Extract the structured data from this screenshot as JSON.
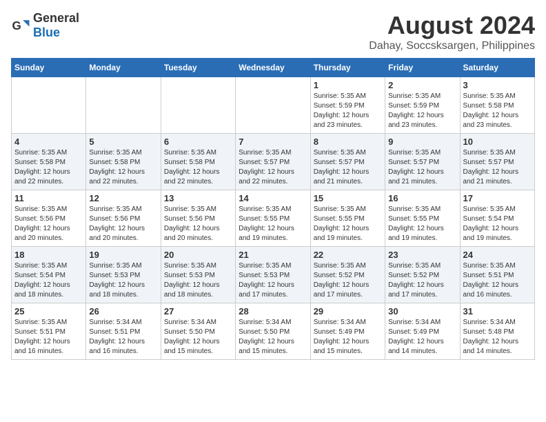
{
  "header": {
    "logo_general": "General",
    "logo_blue": "Blue",
    "title": "August 2024",
    "subtitle": "Dahay, Soccsksargen, Philippines"
  },
  "calendar": {
    "days_of_week": [
      "Sunday",
      "Monday",
      "Tuesday",
      "Wednesday",
      "Thursday",
      "Friday",
      "Saturday"
    ],
    "weeks": [
      {
        "cells": [
          {
            "day": "",
            "detail": ""
          },
          {
            "day": "",
            "detail": ""
          },
          {
            "day": "",
            "detail": ""
          },
          {
            "day": "",
            "detail": ""
          },
          {
            "day": "1",
            "detail": "Sunrise: 5:35 AM\nSunset: 5:59 PM\nDaylight: 12 hours\nand 23 minutes."
          },
          {
            "day": "2",
            "detail": "Sunrise: 5:35 AM\nSunset: 5:59 PM\nDaylight: 12 hours\nand 23 minutes."
          },
          {
            "day": "3",
            "detail": "Sunrise: 5:35 AM\nSunset: 5:58 PM\nDaylight: 12 hours\nand 23 minutes."
          }
        ]
      },
      {
        "cells": [
          {
            "day": "4",
            "detail": "Sunrise: 5:35 AM\nSunset: 5:58 PM\nDaylight: 12 hours\nand 22 minutes."
          },
          {
            "day": "5",
            "detail": "Sunrise: 5:35 AM\nSunset: 5:58 PM\nDaylight: 12 hours\nand 22 minutes."
          },
          {
            "day": "6",
            "detail": "Sunrise: 5:35 AM\nSunset: 5:58 PM\nDaylight: 12 hours\nand 22 minutes."
          },
          {
            "day": "7",
            "detail": "Sunrise: 5:35 AM\nSunset: 5:57 PM\nDaylight: 12 hours\nand 22 minutes."
          },
          {
            "day": "8",
            "detail": "Sunrise: 5:35 AM\nSunset: 5:57 PM\nDaylight: 12 hours\nand 21 minutes."
          },
          {
            "day": "9",
            "detail": "Sunrise: 5:35 AM\nSunset: 5:57 PM\nDaylight: 12 hours\nand 21 minutes."
          },
          {
            "day": "10",
            "detail": "Sunrise: 5:35 AM\nSunset: 5:57 PM\nDaylight: 12 hours\nand 21 minutes."
          }
        ]
      },
      {
        "cells": [
          {
            "day": "11",
            "detail": "Sunrise: 5:35 AM\nSunset: 5:56 PM\nDaylight: 12 hours\nand 20 minutes."
          },
          {
            "day": "12",
            "detail": "Sunrise: 5:35 AM\nSunset: 5:56 PM\nDaylight: 12 hours\nand 20 minutes."
          },
          {
            "day": "13",
            "detail": "Sunrise: 5:35 AM\nSunset: 5:56 PM\nDaylight: 12 hours\nand 20 minutes."
          },
          {
            "day": "14",
            "detail": "Sunrise: 5:35 AM\nSunset: 5:55 PM\nDaylight: 12 hours\nand 19 minutes."
          },
          {
            "day": "15",
            "detail": "Sunrise: 5:35 AM\nSunset: 5:55 PM\nDaylight: 12 hours\nand 19 minutes."
          },
          {
            "day": "16",
            "detail": "Sunrise: 5:35 AM\nSunset: 5:55 PM\nDaylight: 12 hours\nand 19 minutes."
          },
          {
            "day": "17",
            "detail": "Sunrise: 5:35 AM\nSunset: 5:54 PM\nDaylight: 12 hours\nand 19 minutes."
          }
        ]
      },
      {
        "cells": [
          {
            "day": "18",
            "detail": "Sunrise: 5:35 AM\nSunset: 5:54 PM\nDaylight: 12 hours\nand 18 minutes."
          },
          {
            "day": "19",
            "detail": "Sunrise: 5:35 AM\nSunset: 5:53 PM\nDaylight: 12 hours\nand 18 minutes."
          },
          {
            "day": "20",
            "detail": "Sunrise: 5:35 AM\nSunset: 5:53 PM\nDaylight: 12 hours\nand 18 minutes."
          },
          {
            "day": "21",
            "detail": "Sunrise: 5:35 AM\nSunset: 5:53 PM\nDaylight: 12 hours\nand 17 minutes."
          },
          {
            "day": "22",
            "detail": "Sunrise: 5:35 AM\nSunset: 5:52 PM\nDaylight: 12 hours\nand 17 minutes."
          },
          {
            "day": "23",
            "detail": "Sunrise: 5:35 AM\nSunset: 5:52 PM\nDaylight: 12 hours\nand 17 minutes."
          },
          {
            "day": "24",
            "detail": "Sunrise: 5:35 AM\nSunset: 5:51 PM\nDaylight: 12 hours\nand 16 minutes."
          }
        ]
      },
      {
        "cells": [
          {
            "day": "25",
            "detail": "Sunrise: 5:35 AM\nSunset: 5:51 PM\nDaylight: 12 hours\nand 16 minutes."
          },
          {
            "day": "26",
            "detail": "Sunrise: 5:34 AM\nSunset: 5:51 PM\nDaylight: 12 hours\nand 16 minutes."
          },
          {
            "day": "27",
            "detail": "Sunrise: 5:34 AM\nSunset: 5:50 PM\nDaylight: 12 hours\nand 15 minutes."
          },
          {
            "day": "28",
            "detail": "Sunrise: 5:34 AM\nSunset: 5:50 PM\nDaylight: 12 hours\nand 15 minutes."
          },
          {
            "day": "29",
            "detail": "Sunrise: 5:34 AM\nSunset: 5:49 PM\nDaylight: 12 hours\nand 15 minutes."
          },
          {
            "day": "30",
            "detail": "Sunrise: 5:34 AM\nSunset: 5:49 PM\nDaylight: 12 hours\nand 14 minutes."
          },
          {
            "day": "31",
            "detail": "Sunrise: 5:34 AM\nSunset: 5:48 PM\nDaylight: 12 hours\nand 14 minutes."
          }
        ]
      }
    ]
  }
}
